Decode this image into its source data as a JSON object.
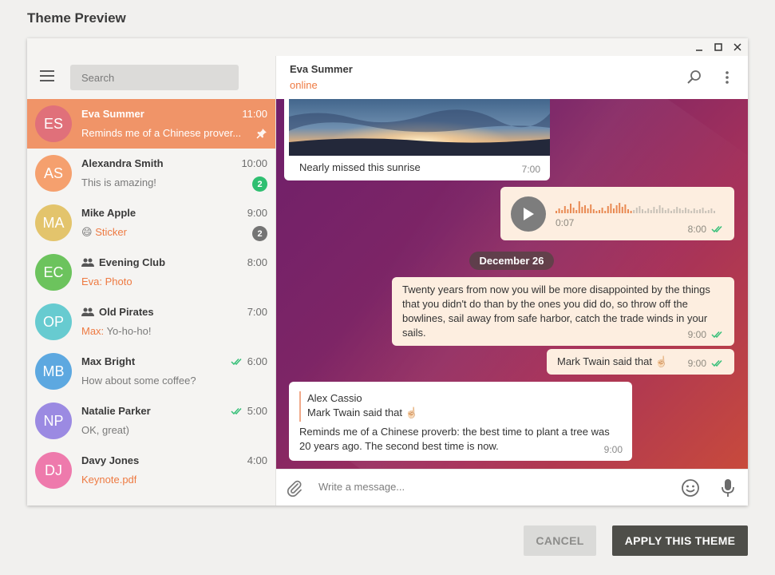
{
  "dialog": {
    "title": "Theme Preview",
    "cancel_label": "CANCEL",
    "apply_label": "APPLY THIS THEME"
  },
  "sidebar": {
    "search_placeholder": "Search",
    "chats": [
      {
        "initials": "ES",
        "name": "Eva Summer",
        "time": "11:00",
        "message": "Reminds me of a Chinese prover...",
        "avatar_color": "#e0707a",
        "active": true,
        "pinned": true
      },
      {
        "initials": "AS",
        "name": "Alexandra Smith",
        "time": "10:00",
        "message": "This is amazing!",
        "avatar_color": "#f5a06e",
        "badge": "2",
        "badge_color": "#2fbf71"
      },
      {
        "initials": "MA",
        "name": "Mike Apple",
        "time": "9:00",
        "message_emoji": "😄",
        "message": "Sticker",
        "avatar_color": "#e3c46c",
        "badge": "2",
        "badge_color": "#747474"
      },
      {
        "initials": "EC",
        "name": "Evening Club",
        "time": "8:00",
        "message": "Eva: Photo",
        "avatar_color": "#6cc35d",
        "group": true
      },
      {
        "initials": "OP",
        "name": "Old Pirates",
        "time": "7:00",
        "sender": "Max:",
        "message": "Yo-ho-ho!",
        "avatar_color": "#67cbd0",
        "group": true
      },
      {
        "initials": "MB",
        "name": "Max Bright",
        "time": "6:00",
        "message": "How about some coffee?",
        "avatar_color": "#5da8e0",
        "read": true
      },
      {
        "initials": "NP",
        "name": "Natalie Parker",
        "time": "5:00",
        "message": "OK, great)",
        "avatar_color": "#9b8ae2",
        "read": true
      },
      {
        "initials": "DJ",
        "name": "Davy Jones",
        "time": "4:00",
        "message": "Keynote.pdf",
        "avatar_color": "#ee7aac"
      }
    ]
  },
  "chat": {
    "peer_name": "Eva Summer",
    "peer_status": "online",
    "date_separator": "December 26",
    "messages": {
      "photo_caption": "Nearly missed this sunrise",
      "photo_time": "7:00",
      "voice_duration": "0:07",
      "voice_time": "8:00",
      "quote_text": "Twenty years from now you will be more disappointed by the things that you didn't do than by the ones you did do, so throw off the bowlines, sail away from safe harbor, catch the trade winds in your sails.",
      "quote_time": "9:00",
      "twain_text": "Mark Twain said that ☝🏻",
      "twain_time": "9:00",
      "reply_author": "Alex Cassio",
      "reply_quote": "Mark Twain said that ☝🏻",
      "reply_text": "Reminds me of a Chinese proverb: the best time to plant a tree was 20 years ago. The second best time is now.",
      "reply_time": "9:00"
    },
    "composer_placeholder": "Write a message..."
  },
  "colors": {
    "accent": "#ee7a42",
    "active_row": "#f09468",
    "read_check": "#39c07a"
  }
}
